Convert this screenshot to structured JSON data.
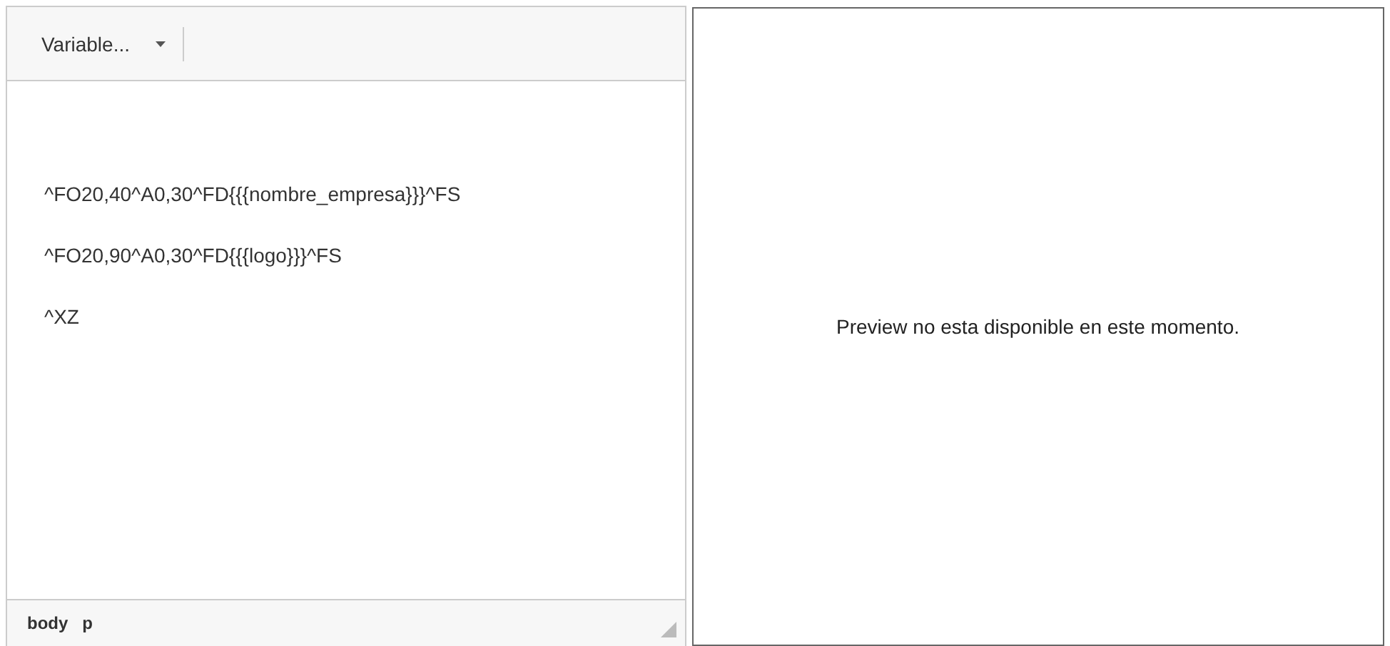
{
  "toolbar": {
    "variable_dropdown": "Variable..."
  },
  "editor": {
    "lines": [
      "^FO20,40^A0,30^FD{{{nombre_empresa}}}^FS",
      "^FO20,90^A0,30^FD{{{logo}}}^FS",
      "^XZ"
    ]
  },
  "status_bar": {
    "path": [
      "body",
      "p"
    ]
  },
  "preview": {
    "message": "Preview no esta disponible en este momento."
  }
}
